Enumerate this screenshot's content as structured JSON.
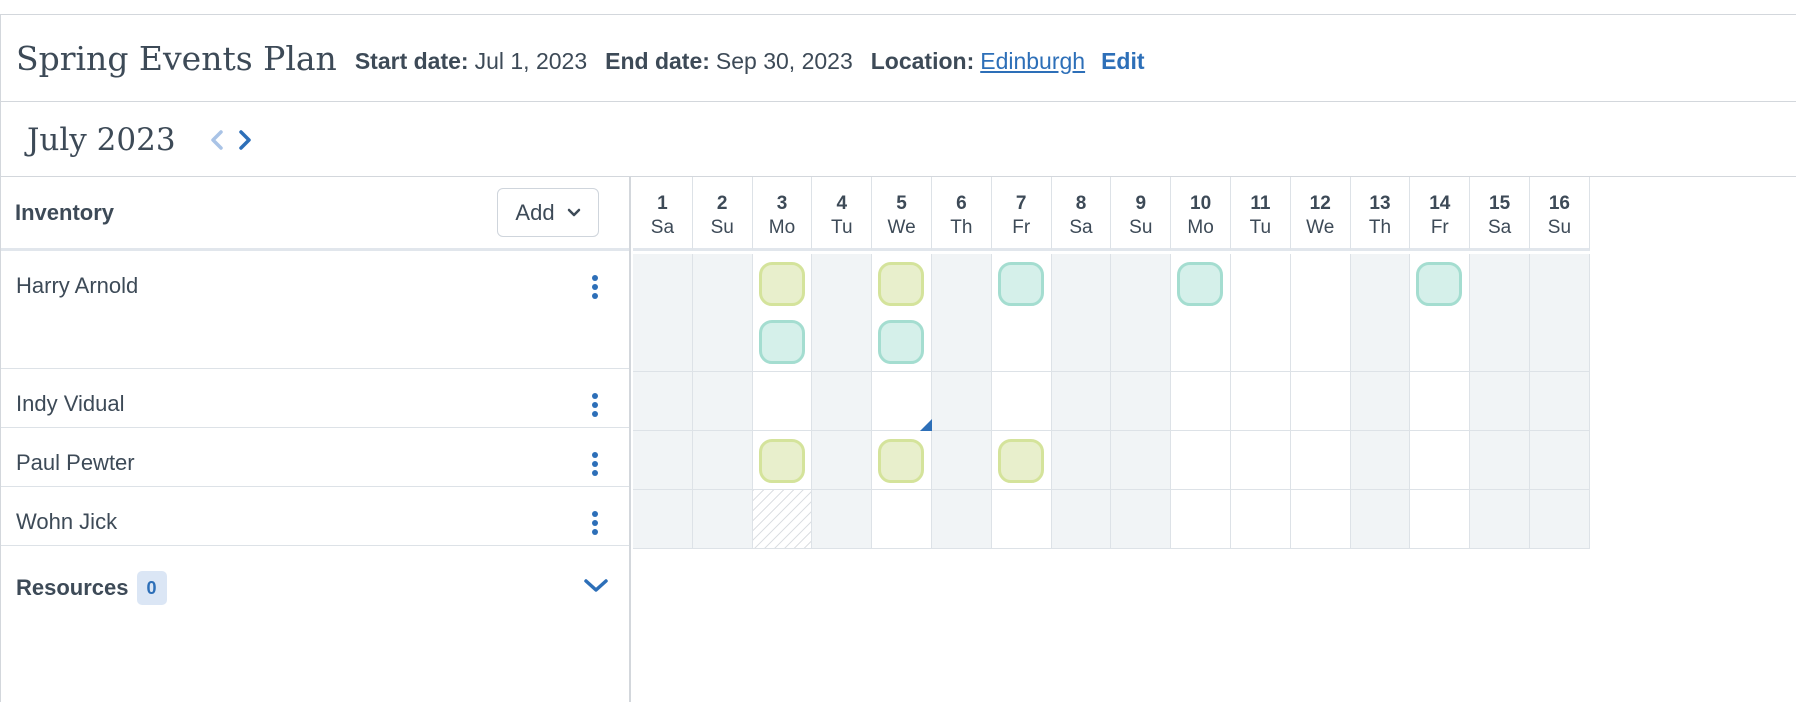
{
  "header": {
    "title": "Spring Events Plan",
    "start_label": "Start date:",
    "start_value": "Jul 1, 2023",
    "end_label": "End date:",
    "end_value": "Sep 30, 2023",
    "location_label": "Location:",
    "location_value": "Edinburgh",
    "edit_label": "Edit"
  },
  "calendar": {
    "month_title": "July 2023",
    "days": [
      {
        "num": "1",
        "wd": "Sa",
        "weekend": true
      },
      {
        "num": "2",
        "wd": "Su",
        "weekend": true
      },
      {
        "num": "3",
        "wd": "Mo",
        "weekend": false
      },
      {
        "num": "4",
        "wd": "Tu",
        "weekend": true
      },
      {
        "num": "5",
        "wd": "We",
        "weekend": false
      },
      {
        "num": "6",
        "wd": "Th",
        "weekend": true
      },
      {
        "num": "7",
        "wd": "Fr",
        "weekend": false
      },
      {
        "num": "8",
        "wd": "Sa",
        "weekend": true
      },
      {
        "num": "9",
        "wd": "Su",
        "weekend": true
      },
      {
        "num": "10",
        "wd": "Mo",
        "weekend": false
      },
      {
        "num": "11",
        "wd": "Tu",
        "weekend": false
      },
      {
        "num": "12",
        "wd": "We",
        "weekend": false
      },
      {
        "num": "13",
        "wd": "Th",
        "weekend": true
      },
      {
        "num": "14",
        "wd": "Fr",
        "weekend": false
      },
      {
        "num": "15",
        "wd": "Sa",
        "weekend": true
      },
      {
        "num": "16",
        "wd": "Su",
        "weekend": true
      }
    ]
  },
  "inventory": {
    "title": "Inventory",
    "add_label": "Add",
    "rows": [
      {
        "name": "Harry Arnold",
        "events": [
          {
            "day": 3,
            "slot": 0,
            "color": "yellow"
          },
          {
            "day": 5,
            "slot": 0,
            "color": "yellow"
          },
          {
            "day": 7,
            "slot": 0,
            "color": "teal"
          },
          {
            "day": 10,
            "slot": 0,
            "color": "teal"
          },
          {
            "day": 14,
            "slot": 0,
            "color": "teal"
          },
          {
            "day": 3,
            "slot": 1,
            "color": "teal"
          },
          {
            "day": 5,
            "slot": 1,
            "color": "teal"
          }
        ]
      },
      {
        "name": "Indy Vidual",
        "events": []
      },
      {
        "name": "Paul Pewter",
        "events": [
          {
            "day": 3,
            "slot": 0,
            "color": "yellow"
          },
          {
            "day": 5,
            "slot": 0,
            "color": "yellow"
          },
          {
            "day": 7,
            "slot": 0,
            "color": "yellow"
          }
        ]
      },
      {
        "name": "Wohn Jick",
        "events": [],
        "unavailable_days": [
          3
        ]
      }
    ]
  },
  "resources": {
    "title": "Resources",
    "count": "0"
  },
  "colors": {
    "accent": "#2d6fb8",
    "chip_yellow": "#e8efcc",
    "chip_teal": "#d5f0ea",
    "weekend_bg": "#f1f4f6"
  }
}
